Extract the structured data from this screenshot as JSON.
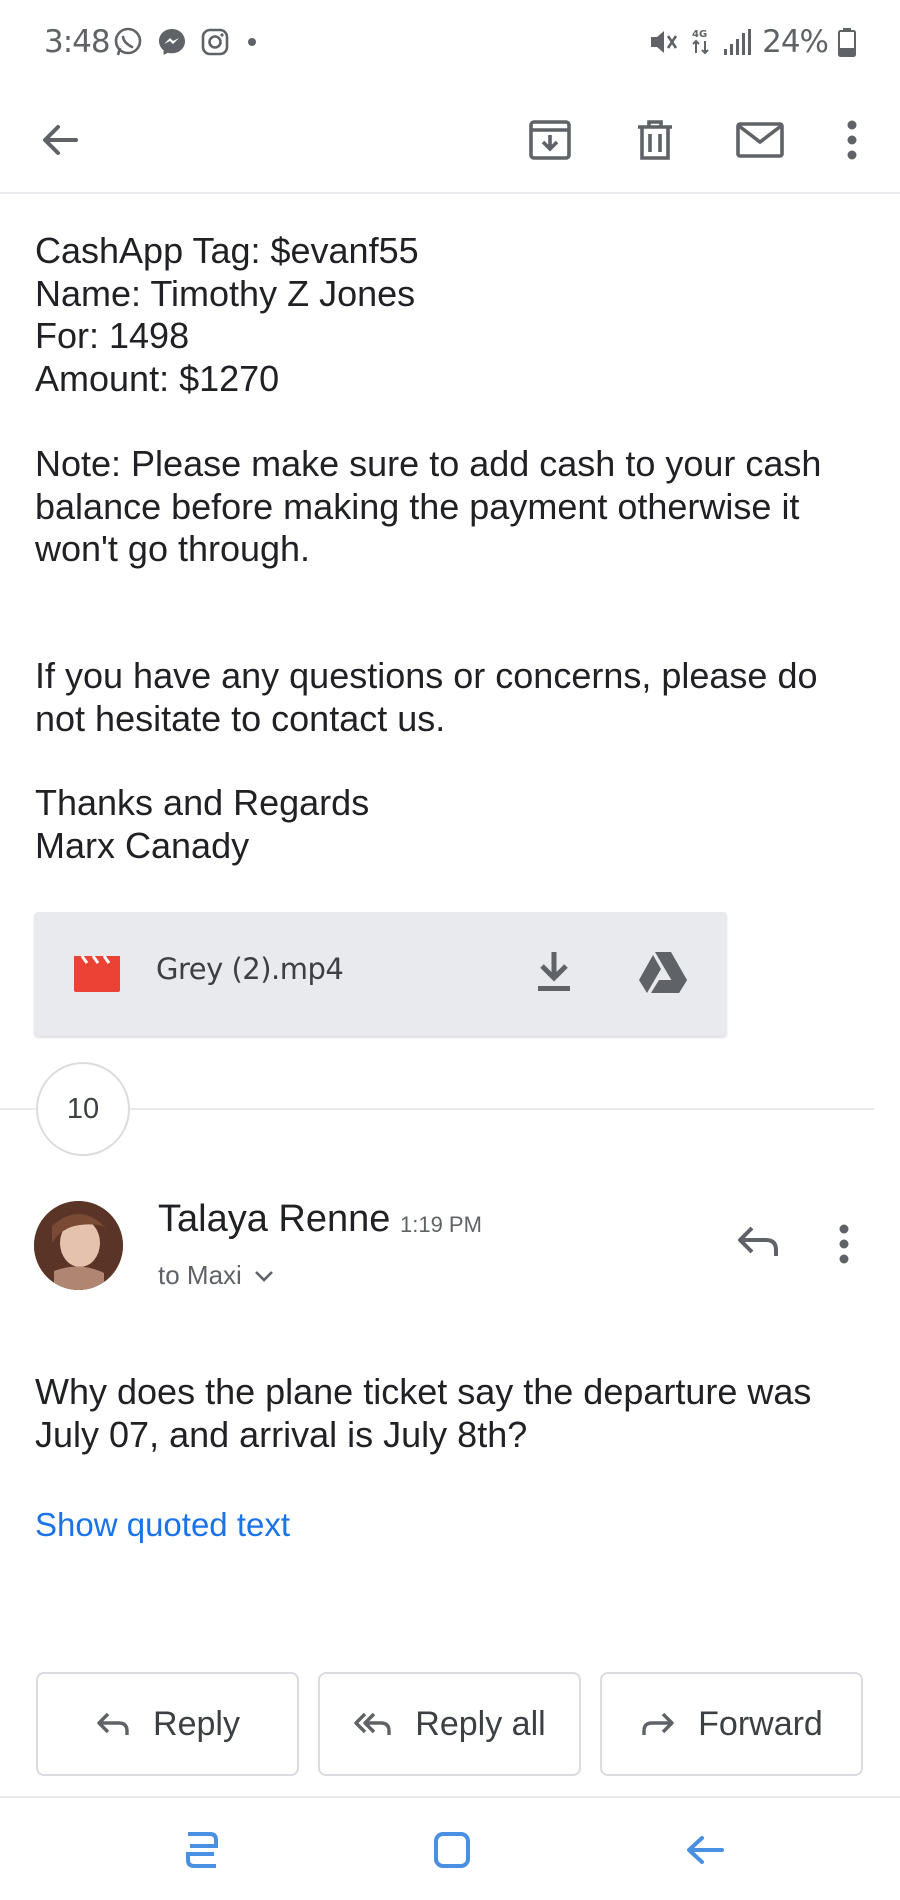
{
  "status_bar": {
    "time": "3:48",
    "battery": "24%",
    "icons": [
      "whatsapp-icon",
      "messenger-icon",
      "instagram-icon",
      "dot-icon",
      "mute-icon",
      "4g-icon",
      "signal-icon",
      "battery-icon"
    ]
  },
  "toolbar": {
    "icons": [
      "back-arrow-icon",
      "archive-icon",
      "delete-icon",
      "mark-unread-icon",
      "more-vert-icon"
    ]
  },
  "email_body": {
    "lines_block1": [
      "CashApp Tag: $evanf55",
      "Name: Timothy Z Jones",
      "For: 1498",
      "Amount: $1270"
    ],
    "lines_note": [
      "Note: Please make sure to add cash to your cash",
      "balance before making the payment otherwise it",
      "won't go through."
    ],
    "lines_questions": [
      "If you have any questions or concerns, please do",
      "not hesitate to contact us."
    ],
    "lines_signoff": [
      "Thanks and Regards",
      "Marx Canady"
    ]
  },
  "attachment": {
    "file_name": "Grey (2).mp4",
    "icon": "video-file-icon",
    "actions": [
      "download-icon",
      "drive-icon"
    ]
  },
  "collapsed_count": "10",
  "message": {
    "sender": "Talaya Renne",
    "time": "1:19 PM",
    "recipient": "to Maxi",
    "lines_body": [
      "Why does the plane ticket say the departure was",
      "July 07, and arrival is July 8th?"
    ],
    "show_quoted": "Show quoted text"
  },
  "actions": {
    "reply": "Reply",
    "reply_all": "Reply all",
    "forward": "Forward"
  },
  "colors": {
    "link": "#1a73e8",
    "attachment_bg": "#e8eaed",
    "video_icon": "#ea4335",
    "nav_icon": "#4a90e2"
  }
}
